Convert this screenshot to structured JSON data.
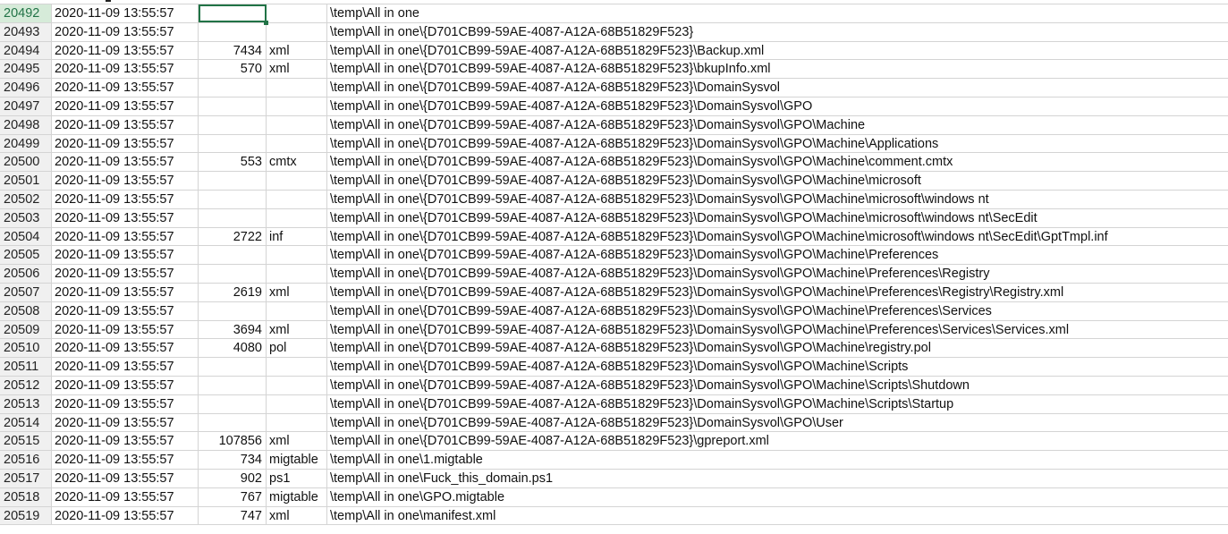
{
  "rows": [
    {
      "num": "20492",
      "time": "2020-11-09 13:55:57",
      "size": "",
      "ext": "",
      "path": "\\temp\\All in one"
    },
    {
      "num": "20493",
      "time": "2020-11-09 13:55:57",
      "size": "",
      "ext": "",
      "path": "\\temp\\All in one\\{D701CB99-59AE-4087-A12A-68B51829F523}"
    },
    {
      "num": "20494",
      "time": "2020-11-09 13:55:57",
      "size": "7434",
      "ext": "xml",
      "path": "\\temp\\All in one\\{D701CB99-59AE-4087-A12A-68B51829F523}\\Backup.xml"
    },
    {
      "num": "20495",
      "time": "2020-11-09 13:55:57",
      "size": "570",
      "ext": "xml",
      "path": "\\temp\\All in one\\{D701CB99-59AE-4087-A12A-68B51829F523}\\bkupInfo.xml"
    },
    {
      "num": "20496",
      "time": "2020-11-09 13:55:57",
      "size": "",
      "ext": "",
      "path": "\\temp\\All in one\\{D701CB99-59AE-4087-A12A-68B51829F523}\\DomainSysvol"
    },
    {
      "num": "20497",
      "time": "2020-11-09 13:55:57",
      "size": "",
      "ext": "",
      "path": "\\temp\\All in one\\{D701CB99-59AE-4087-A12A-68B51829F523}\\DomainSysvol\\GPO"
    },
    {
      "num": "20498",
      "time": "2020-11-09 13:55:57",
      "size": "",
      "ext": "",
      "path": "\\temp\\All in one\\{D701CB99-59AE-4087-A12A-68B51829F523}\\DomainSysvol\\GPO\\Machine"
    },
    {
      "num": "20499",
      "time": "2020-11-09 13:55:57",
      "size": "",
      "ext": "",
      "path": "\\temp\\All in one\\{D701CB99-59AE-4087-A12A-68B51829F523}\\DomainSysvol\\GPO\\Machine\\Applications"
    },
    {
      "num": "20500",
      "time": "2020-11-09 13:55:57",
      "size": "553",
      "ext": "cmtx",
      "path": "\\temp\\All in one\\{D701CB99-59AE-4087-A12A-68B51829F523}\\DomainSysvol\\GPO\\Machine\\comment.cmtx"
    },
    {
      "num": "20501",
      "time": "2020-11-09 13:55:57",
      "size": "",
      "ext": "",
      "path": "\\temp\\All in one\\{D701CB99-59AE-4087-A12A-68B51829F523}\\DomainSysvol\\GPO\\Machine\\microsoft"
    },
    {
      "num": "20502",
      "time": "2020-11-09 13:55:57",
      "size": "",
      "ext": "",
      "path": "\\temp\\All in one\\{D701CB99-59AE-4087-A12A-68B51829F523}\\DomainSysvol\\GPO\\Machine\\microsoft\\windows nt"
    },
    {
      "num": "20503",
      "time": "2020-11-09 13:55:57",
      "size": "",
      "ext": "",
      "path": "\\temp\\All in one\\{D701CB99-59AE-4087-A12A-68B51829F523}\\DomainSysvol\\GPO\\Machine\\microsoft\\windows nt\\SecEdit"
    },
    {
      "num": "20504",
      "time": "2020-11-09 13:55:57",
      "size": "2722",
      "ext": "inf",
      "path": "\\temp\\All in one\\{D701CB99-59AE-4087-A12A-68B51829F523}\\DomainSysvol\\GPO\\Machine\\microsoft\\windows nt\\SecEdit\\GptTmpl.inf"
    },
    {
      "num": "20505",
      "time": "2020-11-09 13:55:57",
      "size": "",
      "ext": "",
      "path": "\\temp\\All in one\\{D701CB99-59AE-4087-A12A-68B51829F523}\\DomainSysvol\\GPO\\Machine\\Preferences"
    },
    {
      "num": "20506",
      "time": "2020-11-09 13:55:57",
      "size": "",
      "ext": "",
      "path": "\\temp\\All in one\\{D701CB99-59AE-4087-A12A-68B51829F523}\\DomainSysvol\\GPO\\Machine\\Preferences\\Registry"
    },
    {
      "num": "20507",
      "time": "2020-11-09 13:55:57",
      "size": "2619",
      "ext": "xml",
      "path": "\\temp\\All in one\\{D701CB99-59AE-4087-A12A-68B51829F523}\\DomainSysvol\\GPO\\Machine\\Preferences\\Registry\\Registry.xml"
    },
    {
      "num": "20508",
      "time": "2020-11-09 13:55:57",
      "size": "",
      "ext": "",
      "path": "\\temp\\All in one\\{D701CB99-59AE-4087-A12A-68B51829F523}\\DomainSysvol\\GPO\\Machine\\Preferences\\Services"
    },
    {
      "num": "20509",
      "time": "2020-11-09 13:55:57",
      "size": "3694",
      "ext": "xml",
      "path": "\\temp\\All in one\\{D701CB99-59AE-4087-A12A-68B51829F523}\\DomainSysvol\\GPO\\Machine\\Preferences\\Services\\Services.xml"
    },
    {
      "num": "20510",
      "time": "2020-11-09 13:55:57",
      "size": "4080",
      "ext": "pol",
      "path": "\\temp\\All in one\\{D701CB99-59AE-4087-A12A-68B51829F523}\\DomainSysvol\\GPO\\Machine\\registry.pol"
    },
    {
      "num": "20511",
      "time": "2020-11-09 13:55:57",
      "size": "",
      "ext": "",
      "path": "\\temp\\All in one\\{D701CB99-59AE-4087-A12A-68B51829F523}\\DomainSysvol\\GPO\\Machine\\Scripts"
    },
    {
      "num": "20512",
      "time": "2020-11-09 13:55:57",
      "size": "",
      "ext": "",
      "path": "\\temp\\All in one\\{D701CB99-59AE-4087-A12A-68B51829F523}\\DomainSysvol\\GPO\\Machine\\Scripts\\Shutdown"
    },
    {
      "num": "20513",
      "time": "2020-11-09 13:55:57",
      "size": "",
      "ext": "",
      "path": "\\temp\\All in one\\{D701CB99-59AE-4087-A12A-68B51829F523}\\DomainSysvol\\GPO\\Machine\\Scripts\\Startup"
    },
    {
      "num": "20514",
      "time": "2020-11-09 13:55:57",
      "size": "",
      "ext": "",
      "path": "\\temp\\All in one\\{D701CB99-59AE-4087-A12A-68B51829F523}\\DomainSysvol\\GPO\\User"
    },
    {
      "num": "20515",
      "time": "2020-11-09 13:55:57",
      "size": "107856",
      "ext": "xml",
      "path": "\\temp\\All in one\\{D701CB99-59AE-4087-A12A-68B51829F523}\\gpreport.xml"
    },
    {
      "num": "20516",
      "time": "2020-11-09 13:55:57",
      "size": "734",
      "ext": "migtable",
      "path": "\\temp\\All in one\\1.migtable"
    },
    {
      "num": "20517",
      "time": "2020-11-09 13:55:57",
      "size": "902",
      "ext": "ps1",
      "path": "\\temp\\All in one\\Fuck_this_domain.ps1"
    },
    {
      "num": "20518",
      "time": "2020-11-09 13:55:57",
      "size": "767",
      "ext": "migtable",
      "path": "\\temp\\All in one\\GPO.migtable"
    },
    {
      "num": "20519",
      "time": "2020-11-09 13:55:57",
      "size": "747",
      "ext": "xml",
      "path": "\\temp\\All in one\\manifest.xml"
    }
  ],
  "selection": {
    "row_index": 0,
    "column": "size"
  },
  "colors": {
    "accent": "#217346",
    "header_bg": "#f0f0f0",
    "gridline": "#d4d4d4"
  }
}
